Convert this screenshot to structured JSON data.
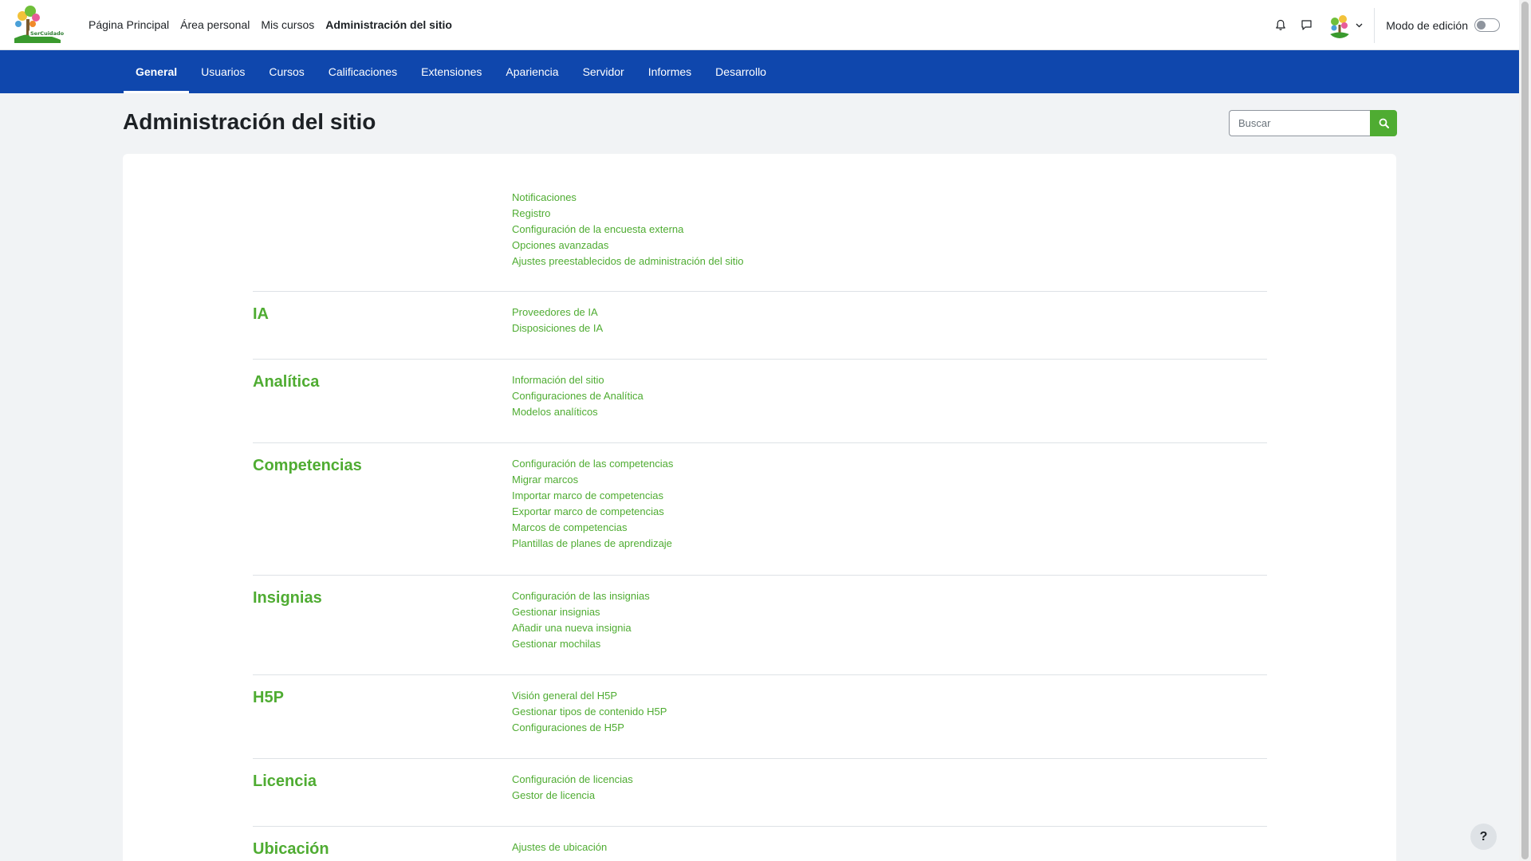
{
  "primary_nav": [
    {
      "label": "Página Principal"
    },
    {
      "label": "Área personal"
    },
    {
      "label": "Mis cursos"
    },
    {
      "label": "Administración del sitio"
    }
  ],
  "user_menu": {
    "edit_mode_label": "Modo de edición"
  },
  "secondary_nav": [
    {
      "label": "General"
    },
    {
      "label": "Usuarios"
    },
    {
      "label": "Cursos"
    },
    {
      "label": "Calificaciones"
    },
    {
      "label": "Extensiones"
    },
    {
      "label": "Apariencia"
    },
    {
      "label": "Servidor"
    },
    {
      "label": "Informes"
    },
    {
      "label": "Desarrollo"
    }
  ],
  "page": {
    "title": "Administración del sitio",
    "search_placeholder": "Buscar"
  },
  "categories": [
    {
      "title": "",
      "links": [
        "Notificaciones",
        "Registro",
        "Configuración de la encuesta externa",
        "Opciones avanzadas",
        "Ajustes preestablecidos de administración del sitio"
      ]
    },
    {
      "title": "IA",
      "links": [
        "Proveedores de IA",
        "Disposiciones de IA"
      ]
    },
    {
      "title": "Analítica",
      "links": [
        "Información del sitio",
        "Configuraciones de Analítica",
        "Modelos analíticos"
      ]
    },
    {
      "title": "Competencias",
      "links": [
        "Configuración de las competencias",
        "Migrar marcos",
        "Importar marco de competencias",
        "Exportar marco de competencias",
        "Marcos de competencias",
        "Plantillas de planes de aprendizaje"
      ]
    },
    {
      "title": "Insignias",
      "links": [
        "Configuración de las insignias",
        "Gestionar insignias",
        "Añadir una nueva insignia",
        "Gestionar mochilas"
      ]
    },
    {
      "title": "H5P",
      "links": [
        "Visión general del H5P",
        "Gestionar tipos de contenido H5P",
        "Configuraciones de H5P"
      ]
    },
    {
      "title": "Licencia",
      "links": [
        "Configuración de licencias",
        "Gestor de licencia"
      ]
    },
    {
      "title": "Ubicación",
      "links": [
        "Ajustes de ubicación"
      ]
    }
  ],
  "help": {
    "label": "?"
  },
  "colors": {
    "brand_blue": "#0f47ad",
    "accent_green": "#4fac32"
  },
  "icons": {
    "notifications": "bell-icon",
    "messages": "chat-icon",
    "search": "search-icon",
    "dropdown": "chevron-down-icon"
  }
}
